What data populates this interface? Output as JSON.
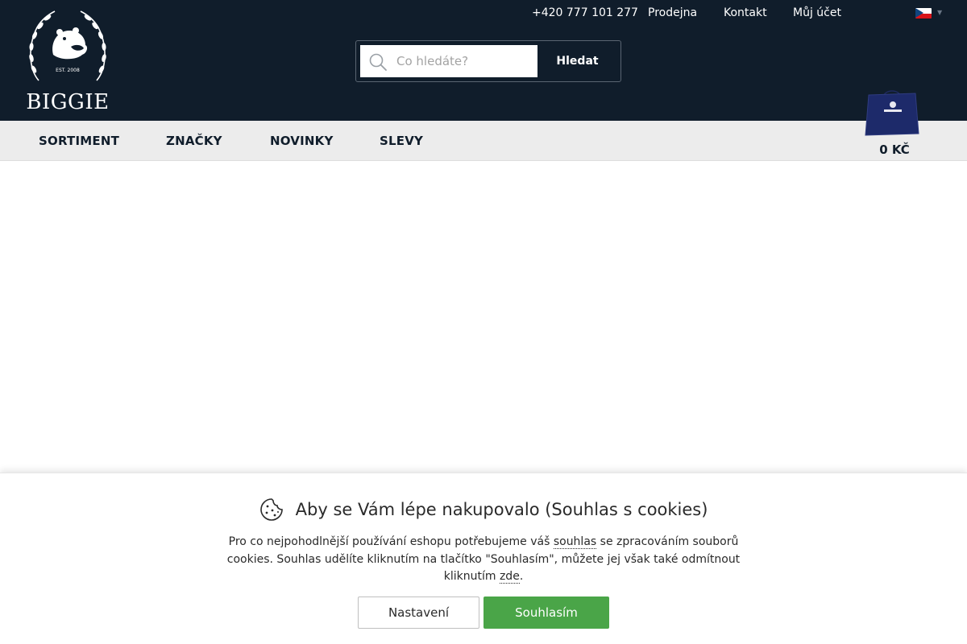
{
  "brand": {
    "logo_text": "BIGGIE",
    "logo_est": "EST. 2008"
  },
  "top_links": {
    "phone": "+420 777 101 277",
    "store": "Prodejna",
    "contact": "Kontakt",
    "account": "Můj účet"
  },
  "language": {
    "icon": "czech-flag-icon"
  },
  "search": {
    "placeholder": "Co hledáte?",
    "button_label": "Hledat",
    "icon": "search-icon"
  },
  "nav": {
    "items": [
      {
        "label": "SORTIMENT"
      },
      {
        "label": "ZNAČKY"
      },
      {
        "label": "NOVINKY"
      },
      {
        "label": "SLEVY"
      }
    ]
  },
  "cart": {
    "total": "0 KČ",
    "icon": "shopping-bag-icon"
  },
  "cookie_bar": {
    "title": "Aby se Vám lépe nakupovalo (Souhlas s cookies)",
    "text_before_consent": "Pro co nejpohodlnější používání eshopu potřebujeme váš ",
    "consent_link": "souhlas",
    "text_middle": " se zpracováním souborů cookies. Souhlas udělíte kliknutím na tlačítko \"Souhlasím\", můžete jej však také odmítnout kliknutím ",
    "here_link": "zde",
    "text_end": ".",
    "settings_button": "Nastavení",
    "accept_button": "Souhlasím",
    "icon": "cookie-icon"
  },
  "colors": {
    "header_bg": "#101d2b",
    "nav_bg": "#ececec",
    "accept_green": "#4aa548"
  }
}
